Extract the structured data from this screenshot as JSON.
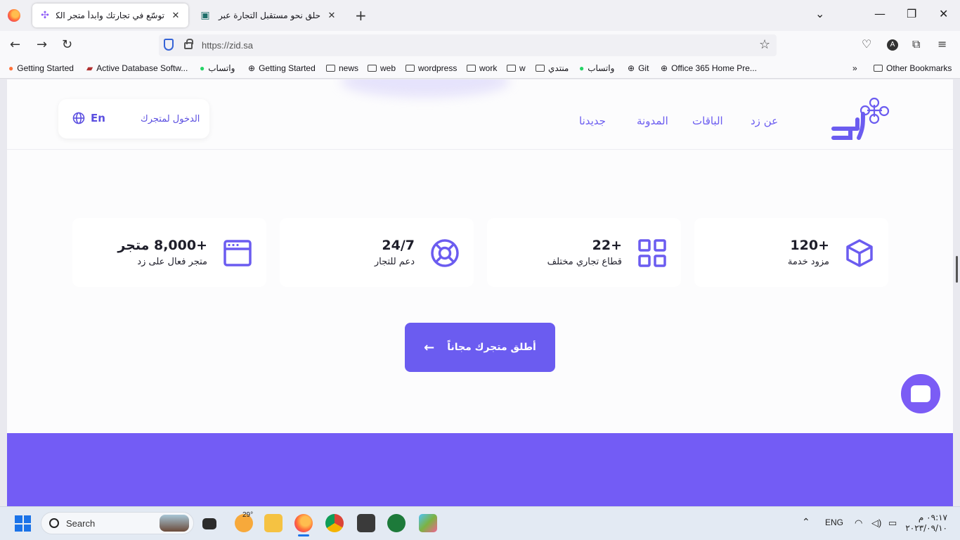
{
  "browser": {
    "tabs": [
      {
        "title": "توسّع في تجارتك وابدأ متجر الكترو",
        "active": true
      },
      {
        "title": "حلق نحو مستقبل التجارة عبر إنشاء",
        "active": false
      }
    ],
    "url": "https://zid.sa",
    "bookmarks": [
      {
        "label": "Getting Started",
        "icon": "firefox-icon"
      },
      {
        "label": "Active Database Softw...",
        "icon": "database-icon"
      },
      {
        "label": "واتساب",
        "icon": "whatsapp-icon"
      },
      {
        "label": "Getting Started",
        "icon": "globe-icon"
      },
      {
        "label": "news",
        "icon": "folder-icon"
      },
      {
        "label": "web",
        "icon": "folder-icon"
      },
      {
        "label": "wordpress",
        "icon": "folder-icon"
      },
      {
        "label": "work",
        "icon": "folder-icon"
      },
      {
        "label": "w",
        "icon": "folder-icon"
      },
      {
        "label": "منتدي",
        "icon": "folder-icon"
      },
      {
        "label": "واتساب",
        "icon": "whatsapp-icon"
      },
      {
        "label": "Git",
        "icon": "globe-icon"
      },
      {
        "label": "Office 365 Home Pre...",
        "icon": "globe-icon"
      },
      {
        "label": "Other Bookmarks",
        "icon": "folder-icon"
      }
    ],
    "avatar_letter": "A"
  },
  "site": {
    "nav": {
      "about": "عن زد",
      "plans": "الباقات",
      "blog": "المدونة",
      "news": "جديدنا"
    },
    "login": "الدخول لمتجرك",
    "lang": "En",
    "stats": [
      {
        "value": "+120",
        "label": "مزود خدمة",
        "icon": "cube-icon"
      },
      {
        "value": "+22",
        "label": "قطاع تجاري مختلف",
        "icon": "grid-icon"
      },
      {
        "value": "24/7",
        "label": "دعم للتجار",
        "icon": "lifebuoy-icon"
      },
      {
        "value": "+8,000 متجر",
        "label": "متجر فعال على زد",
        "icon": "browser-window-icon"
      }
    ],
    "cta": "أطلق متجرك مجاناً",
    "accent": "#6b5cf0",
    "band_color": "#735cf5"
  },
  "taskbar": {
    "search_placeholder": "Search",
    "weather_temp": "29°",
    "lang": "ENG",
    "time": "٠٩:١٧ م",
    "date": "٢٠٢٣/٠٩/١٠"
  }
}
